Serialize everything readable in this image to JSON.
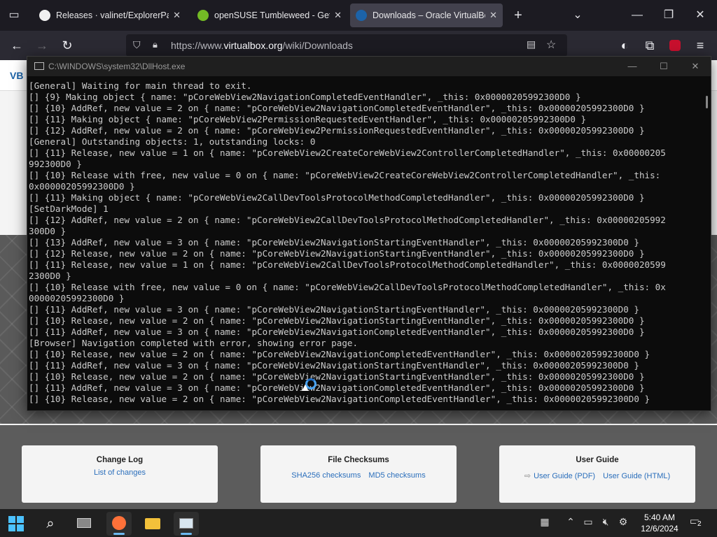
{
  "browser": {
    "tabs": [
      {
        "title": "Releases · valinet/ExplorerPatch",
        "active": false
      },
      {
        "title": "openSUSE Tumbleweed - Get o",
        "active": false
      },
      {
        "title": "Downloads – Oracle VirtualBox",
        "active": true
      }
    ],
    "new_tab_icon": "plus-icon",
    "url_prefix": "https://www.",
    "url_host": "virtualbox.org",
    "url_path": "/wiki/Downloads",
    "accent": "#42414d"
  },
  "page": {
    "cards": [
      {
        "title": "Change Log",
        "links": [
          "List of changes"
        ]
      },
      {
        "title": "File Checksums",
        "links": [
          "SHA256 checksums",
          "MD5 checksums"
        ]
      },
      {
        "title": "User Guide",
        "links": [
          "User Guide (PDF)",
          "User Guide (HTML)"
        ]
      }
    ]
  },
  "console": {
    "title": "C:\\WINDOWS\\system32\\DllHost.exe",
    "lines": [
      "[General] Waiting for main thread to exit.",
      "[] {9} Making object { name: \"pCoreWebView2NavigationCompletedEventHandler\", _this: 0x00000205992300D0 }",
      "[] {10} AddRef, new value = 2 on { name: \"pCoreWebView2NavigationCompletedEventHandler\", _this: 0x00000205992300D0 }",
      "[] {11} Making object { name: \"pCoreWebView2PermissionRequestedEventHandler\", _this: 0x00000205992300D0 }",
      "[] {12} AddRef, new value = 2 on { name: \"pCoreWebView2PermissionRequestedEventHandler\", _this: 0x00000205992300D0 }",
      "[General] Outstanding objects: 1, outstanding locks: 0",
      "[] {11} Release, new value = 1 on { name: \"pCoreWebView2CreateCoreWebView2ControllerCompletedHandler\", _this: 0x00000205",
      "992300D0 }",
      "[] {10} Release with free, new value = 0 on { name: \"pCoreWebView2CreateCoreWebView2ControllerCompletedHandler\", _this:",
      "0x00000205992300D0 }",
      "[] {11} Making object { name: \"pCoreWebView2CallDevToolsProtocolMethodCompletedHandler\", _this: 0x00000205992300D0 }",
      "[SetDarkMode] 1",
      "[] {12} AddRef, new value = 2 on { name: \"pCoreWebView2CallDevToolsProtocolMethodCompletedHandler\", _this: 0x00000205992",
      "300D0 }",
      "[] {13} AddRef, new value = 3 on { name: \"pCoreWebView2NavigationStartingEventHandler\", _this: 0x00000205992300D0 }",
      "[] {12} Release, new value = 2 on { name: \"pCoreWebView2NavigationStartingEventHandler\", _this: 0x00000205992300D0 }",
      "[] {11} Release, new value = 1 on { name: \"pCoreWebView2CallDevToolsProtocolMethodCompletedHandler\", _this: 0x0000020599",
      "2300D0 }",
      "[] {10} Release with free, new value = 0 on { name: \"pCoreWebView2CallDevToolsProtocolMethodCompletedHandler\", _this: 0x",
      "00000205992300D0 }",
      "[] {11} AddRef, new value = 3 on { name: \"pCoreWebView2NavigationStartingEventHandler\", _this: 0x00000205992300D0 }",
      "[] {10} Release, new value = 2 on { name: \"pCoreWebView2NavigationStartingEventHandler\", _this: 0x00000205992300D0 }",
      "[] {11} AddRef, new value = 3 on { name: \"pCoreWebView2NavigationCompletedEventHandler\", _this: 0x00000205992300D0 }",
      "[Browser] Navigation completed with error, showing error page.",
      "[] {10} Release, new value = 2 on { name: \"pCoreWebView2NavigationCompletedEventHandler\", _this: 0x00000205992300D0 }",
      "[] {11} AddRef, new value = 3 on { name: \"pCoreWebView2NavigationStartingEventHandler\", _this: 0x00000205992300D0 }",
      "[] {10} Release, new value = 2 on { name: \"pCoreWebView2NavigationStartingEventHandler\", _this: 0x00000205992300D0 }",
      "[] {11} AddRef, new value = 3 on { name: \"pCoreWebView2NavigationCompletedEventHandler\", _this: 0x00000205992300D0 }",
      "[] {10} Release, new value = 2 on { name: \"pCoreWebView2NavigationCompletedEventHandler\", _this: 0x00000205992300D0 }"
    ]
  },
  "taskbar": {
    "time": "5:40 AM",
    "date": "12/6/2024",
    "notification_count": "2"
  }
}
